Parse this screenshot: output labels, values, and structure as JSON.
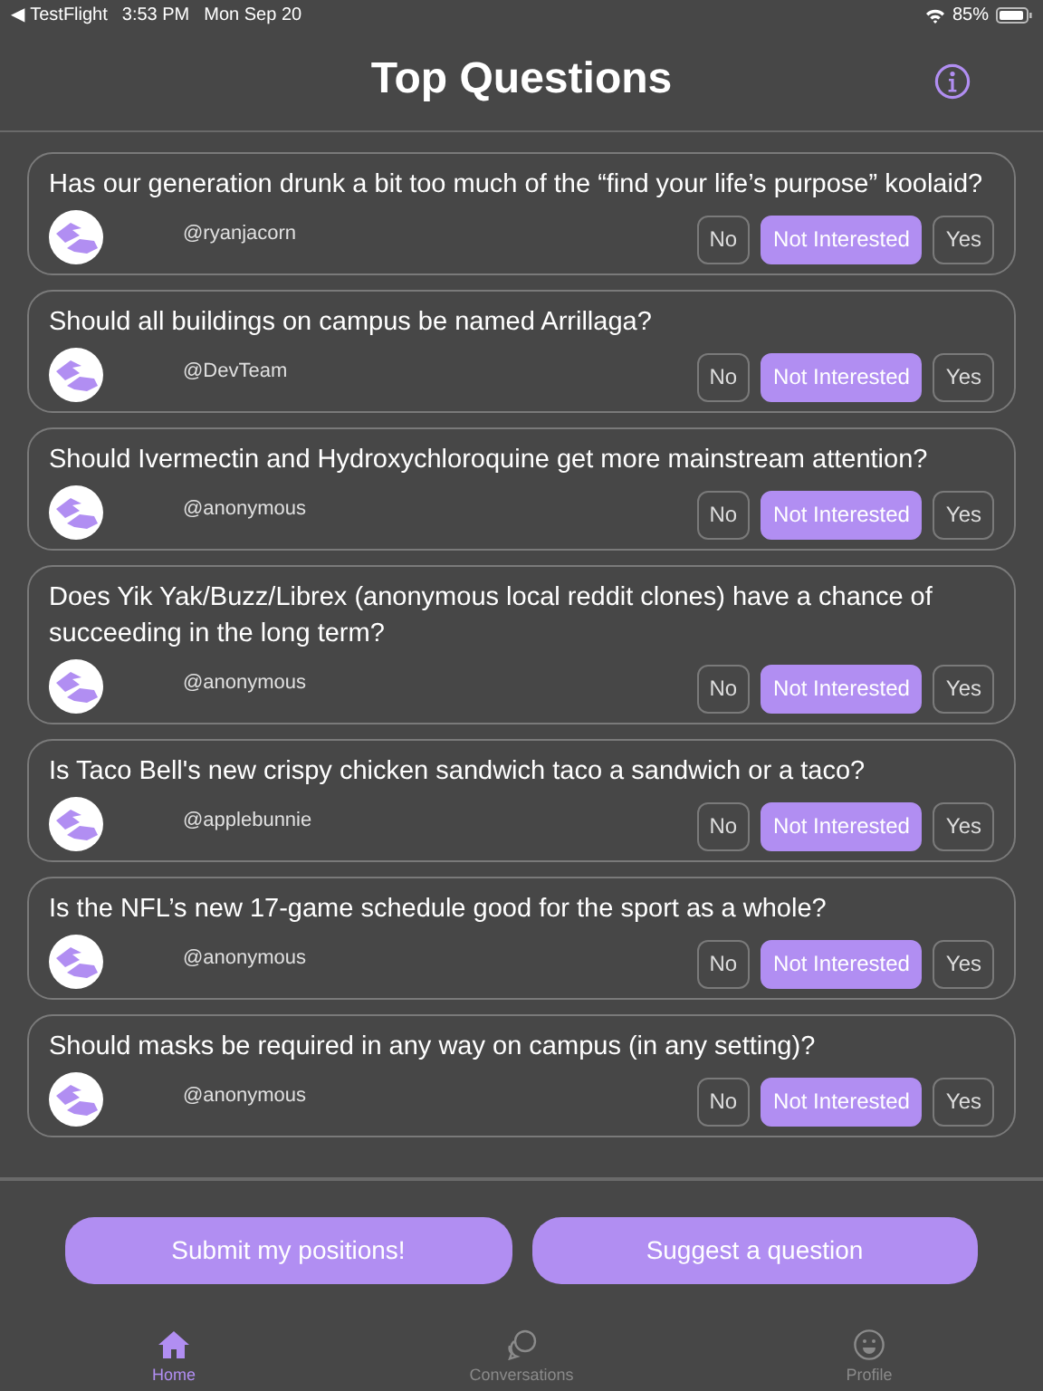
{
  "status_bar": {
    "back_app": "◀ TestFlight",
    "time": "3:53 PM",
    "date": "Mon Sep 20",
    "battery": "85%"
  },
  "header": {
    "title": "Top Questions"
  },
  "questions": [
    {
      "text": "Has our generation drunk a bit too much of the “find your life’s purpose” koolaid?",
      "author": "@ryanjacorn",
      "options": [
        {
          "label": "No",
          "selected": false
        },
        {
          "label": "Not Interested",
          "selected": true
        },
        {
          "label": "Yes",
          "selected": false
        }
      ]
    },
    {
      "text": "Should all buildings on campus be named Arrillaga?",
      "author": "@DevTeam",
      "options": [
        {
          "label": "No",
          "selected": false
        },
        {
          "label": "Not Interested",
          "selected": true
        },
        {
          "label": "Yes",
          "selected": false
        }
      ]
    },
    {
      "text": "Should Ivermectin and Hydroxychloroquine get more mainstream attention?",
      "author": "@anonymous",
      "options": [
        {
          "label": "No",
          "selected": false
        },
        {
          "label": "Not Interested",
          "selected": true
        },
        {
          "label": "Yes",
          "selected": false
        }
      ]
    },
    {
      "text": "Does Yik Yak/Buzz/Librex (anonymous local reddit clones) have a chance of succeeding in the long term?",
      "author": "@anonymous",
      "options": [
        {
          "label": "No",
          "selected": false
        },
        {
          "label": "Not Interested",
          "selected": true
        },
        {
          "label": "Yes",
          "selected": false
        }
      ]
    },
    {
      "text": "Is Taco Bell's new crispy chicken sandwich taco a sandwich or a taco?",
      "author": "@applebunnie",
      "options": [
        {
          "label": "No",
          "selected": false
        },
        {
          "label": "Not Interested",
          "selected": true
        },
        {
          "label": "Yes",
          "selected": false
        }
      ]
    },
    {
      "text": "Is the NFL’s new 17-game schedule good for the sport as a whole?",
      "author": "@anonymous",
      "options": [
        {
          "label": "No",
          "selected": false
        },
        {
          "label": "Not Interested",
          "selected": true
        },
        {
          "label": "Yes",
          "selected": false
        }
      ]
    },
    {
      "text": "Should masks be required in any way on campus (in any setting)?",
      "author": "@anonymous",
      "options": [
        {
          "label": "No",
          "selected": false
        },
        {
          "label": "Not Interested",
          "selected": true
        },
        {
          "label": "Yes",
          "selected": false
        }
      ]
    }
  ],
  "actions": [
    "Submit my positions!",
    "Suggest a question"
  ],
  "tabs": [
    {
      "kind": "home",
      "label": "Home",
      "selected": true
    },
    {
      "kind": "conversations",
      "label": "Conversations",
      "selected": false
    },
    {
      "kind": "profile",
      "label": "Profile",
      "selected": false
    }
  ]
}
